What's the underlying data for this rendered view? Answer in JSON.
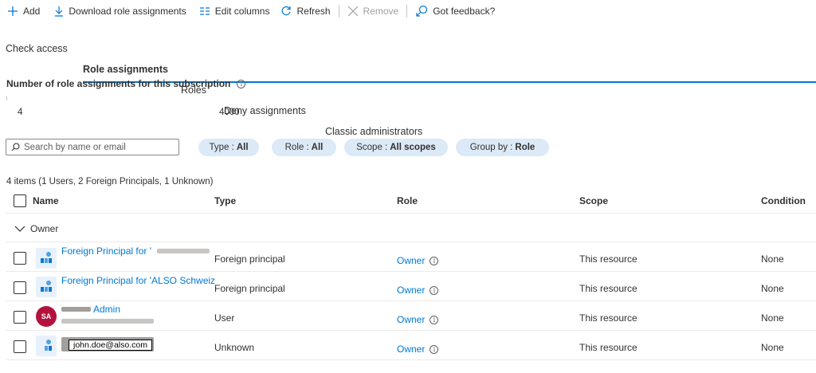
{
  "toolbar": {
    "add": "Add",
    "download": "Download role assignments",
    "edit_columns": "Edit columns",
    "refresh": "Refresh",
    "remove": "Remove",
    "feedback": "Got feedback?"
  },
  "tabs": [
    "Check access",
    "Role assignments",
    "Roles",
    "Deny assignments",
    "Classic administrators"
  ],
  "active_tab": "Role assignments",
  "count": {
    "title": "Number of role assignments for this subscription",
    "current": "4",
    "limit": "4000"
  },
  "search": {
    "placeholder": "Search by name or email"
  },
  "filters": [
    {
      "label": "Type :",
      "value": "All"
    },
    {
      "label": "Role :",
      "value": "All"
    },
    {
      "label": "Scope :",
      "value": "All scopes"
    },
    {
      "label": "Group by :",
      "value": "Role"
    }
  ],
  "summary": "4 items (1 Users, 2 Foreign Principals, 1 Unknown)",
  "columns": [
    "Name",
    "Type",
    "Role",
    "Scope",
    "Condition"
  ],
  "group": {
    "label": "Owner"
  },
  "rows": [
    {
      "name": "Foreign Principal for '",
      "type": "Foreign principal",
      "role": "Owner",
      "scope": "This resource",
      "condition": "None"
    },
    {
      "name": "Foreign Principal for 'ALSO Schweiz",
      "type": "Foreign principal",
      "role": "Owner",
      "scope": "This resource",
      "condition": "None"
    },
    {
      "name": "Admin",
      "avatar": "SA",
      "type": "User",
      "role": "Owner",
      "scope": "This resource",
      "condition": "None"
    },
    {
      "name": "john.doe@also.com",
      "type": "Unknown",
      "role": "Owner",
      "scope": "This resource",
      "condition": "None"
    }
  ],
  "colors": {
    "accent": "#0078d4",
    "pill_bg": "#dce9f7",
    "avatar_user": "#b4123c"
  },
  "icons": [
    "plus-icon",
    "download-icon",
    "columns-icon",
    "refresh-icon",
    "close-icon",
    "feedback-icon",
    "info-icon",
    "search-icon",
    "chevron-down-icon",
    "app-icon"
  ]
}
